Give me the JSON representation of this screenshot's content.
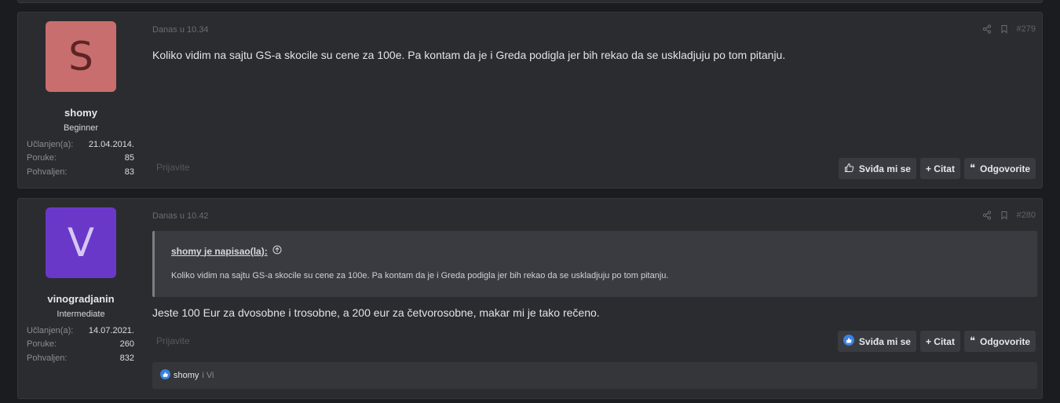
{
  "posts": [
    {
      "avatar_letter": "S",
      "username": "shomy",
      "rank": "Beginner",
      "joined_label": "Učlanjen(a):",
      "joined": "21.04.2014.",
      "messages_label": "Poruke:",
      "messages": "85",
      "praised_label": "Pohvaljen:",
      "praised": "83",
      "date": "Danas u 10.34",
      "post_number": "#279",
      "text": "Koliko vidim na sajtu GS-a skocile su cene za 100e. Pa kontam da je i Greda podigla jer bih rekao da se uskladjuju po tom pitanju.",
      "report": "Prijavite",
      "like_label": "Sviđa mi se",
      "quote_label": "+ Citat",
      "reply_label": "Odgovorite"
    },
    {
      "avatar_letter": "V",
      "username": "vinogradjanin",
      "rank": "Intermediate",
      "joined_label": "Učlanjen(a):",
      "joined": "14.07.2021.",
      "messages_label": "Poruke:",
      "messages": "260",
      "praised_label": "Pohvaljen:",
      "praised": "832",
      "date": "Danas u 10.42",
      "post_number": "#280",
      "quote_author": "shomy je napisao(la):",
      "quote_text": "Koliko vidim na sajtu GS-a skocile su cene za 100e. Pa kontam da je i Greda podigla jer bih rekao da se uskladjuju po tom pitanju.",
      "text": "Jeste 100 Eur za dvosobne i trosobne, a 200 eur za četvorosobne, makar mi je tako rečeno.",
      "report": "Prijavite",
      "like_label": "Sviđa mi se",
      "quote_label": "+ Citat",
      "reply_label": "Odgovorite",
      "likes_who": "shomy",
      "likes_rest": "i Vi"
    }
  ],
  "colors": {
    "background": "#1b1c1f",
    "post_bg": "#2b2c30",
    "avatar_s": "#c96e6e",
    "avatar_v": "#6a38c8",
    "like_blue": "#3b82e0"
  },
  "icons": [
    "share-icon",
    "bookmark-icon",
    "thumbs-up-icon",
    "quote-icon",
    "arrow-up-circle-icon",
    "like-reaction-icon"
  ]
}
